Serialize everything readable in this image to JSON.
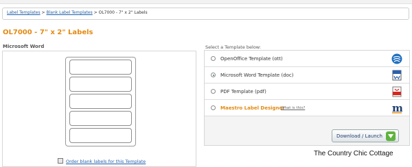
{
  "breadcrumb": {
    "items": [
      "Label Templates",
      "Blank Label Templates"
    ],
    "separator": ">",
    "current": "OL7000 - 7\" x 2\" Labels"
  },
  "page_title": "OL7000 - 7\" x 2\" Labels",
  "preview": {
    "format_label": "Microsoft Word",
    "order_link": "Order blank labels for this Template"
  },
  "templates": {
    "heading": "Select a Template below:",
    "options": [
      {
        "label": "OpenOffice Template (ott)",
        "icon": "openoffice-icon",
        "selected": false
      },
      {
        "label": "Microsoft Word Template (doc)",
        "icon": "word-doc-icon",
        "selected": true
      },
      {
        "label": "PDF Template (pdf)",
        "icon": "pdf-icon",
        "selected": false
      },
      {
        "label": "Maestro Label Designer",
        "icon": "maestro-m-icon",
        "selected": false,
        "extra": "What is this?"
      }
    ],
    "download_label": "Download / Launch"
  },
  "watermark": "The Country Chic Cottage",
  "colors": {
    "accent": "#e38a12",
    "link": "#1f5da8",
    "download_arrow": "#5fb33d"
  }
}
